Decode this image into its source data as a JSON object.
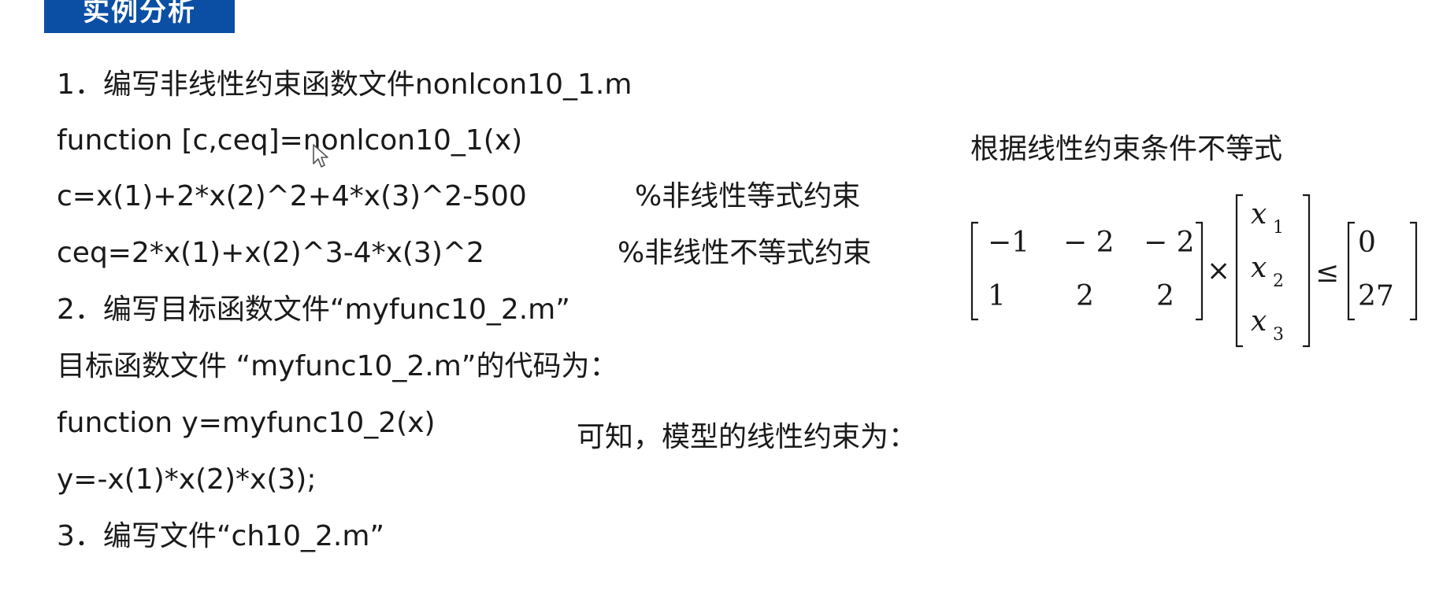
{
  "header": {
    "title": "实例分析"
  },
  "lines": [
    "1．编写非线性约束函数文件nonlcon10_1.m",
    "function [c,ceq]=nonlcon10_1(x)",
    "c=x(1)+2*x(2)^2+4*x(3)^2-500",
    "ceq=2*x(1)+x(2)^3-4*x(3)^2",
    "2．编写目标函数文件“myfunc10_2.m”",
    "目标函数文件 “myfunc10_2.m”的代码为：",
    "function y=myfunc10_2(x)",
    "y=-x(1)*x(2)*x(3);",
    "3．编写文件“ch10_2.m”"
  ],
  "comments": {
    "c_comment": "%非线性等式约束",
    "ceq_comment": "%非线性不等式约束"
  },
  "side": {
    "inequality_label": "根据线性约束条件不等式",
    "model_label": "可知，模型的线性约束为："
  },
  "matrix": {
    "A": [
      [
        "−1",
        "− 2",
        "− 2"
      ],
      [
        "1",
        "2",
        "2"
      ]
    ],
    "x": [
      {
        "base": "x",
        "sub": "1"
      },
      {
        "base": "x",
        "sub": "2"
      },
      {
        "base": "x",
        "sub": "3"
      }
    ],
    "times": "×",
    "leq": "≤",
    "b": [
      "0",
      "27"
    ]
  }
}
